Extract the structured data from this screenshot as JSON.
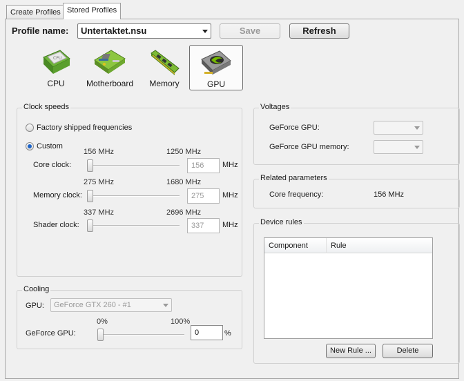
{
  "tabs": [
    {
      "label": "Create Profiles",
      "active": false
    },
    {
      "label": "Stored Profiles",
      "active": true
    }
  ],
  "profile": {
    "label": "Profile name:",
    "value": "Untertaktet.nsu",
    "save_label": "Save",
    "refresh_label": "Refresh"
  },
  "categories": [
    {
      "label": "CPU",
      "icon": "cpu-chip-icon"
    },
    {
      "label": "Motherboard",
      "icon": "motherboard-icon"
    },
    {
      "label": "Memory",
      "icon": "memory-module-icon"
    },
    {
      "label": "GPU",
      "icon": "graphics-card-icon",
      "selected": true
    }
  ],
  "clock_speeds": {
    "title": "Clock speeds",
    "factory_label": "Factory shipped frequencies",
    "custom_label": "Custom",
    "selected": "custom",
    "unit": "MHz",
    "rows": [
      {
        "label": "Core clock:",
        "min": "156 MHz",
        "max": "1250 MHz",
        "value": "156",
        "fraction": 0.0
      },
      {
        "label": "Memory clock:",
        "min": "275 MHz",
        "max": "1680 MHz",
        "value": "275",
        "fraction": 0.0
      },
      {
        "label": "Shader clock:",
        "min": "337 MHz",
        "max": "2696 MHz",
        "value": "337",
        "fraction": 0.0
      }
    ]
  },
  "voltages": {
    "title": "Voltages",
    "rows": [
      {
        "label": "GeForce GPU:",
        "value": ""
      },
      {
        "label": "GeForce GPU memory:",
        "value": ""
      }
    ]
  },
  "related": {
    "title": "Related parameters",
    "core_label": "Core frequency:",
    "core_value": "156 MHz"
  },
  "device_rules": {
    "title": "Device rules",
    "columns": [
      "Component",
      "Rule"
    ],
    "rows": [],
    "new_rule_label": "New Rule ...",
    "delete_label": "Delete"
  },
  "cooling": {
    "title": "Cooling",
    "gpu_label": "GPU:",
    "gpu_value": "GeForce GTX 260 - #1",
    "fan_label": "GeForce GPU:",
    "min": "0%",
    "max": "100%",
    "value": "0",
    "unit": "%",
    "fraction": 0.0
  }
}
